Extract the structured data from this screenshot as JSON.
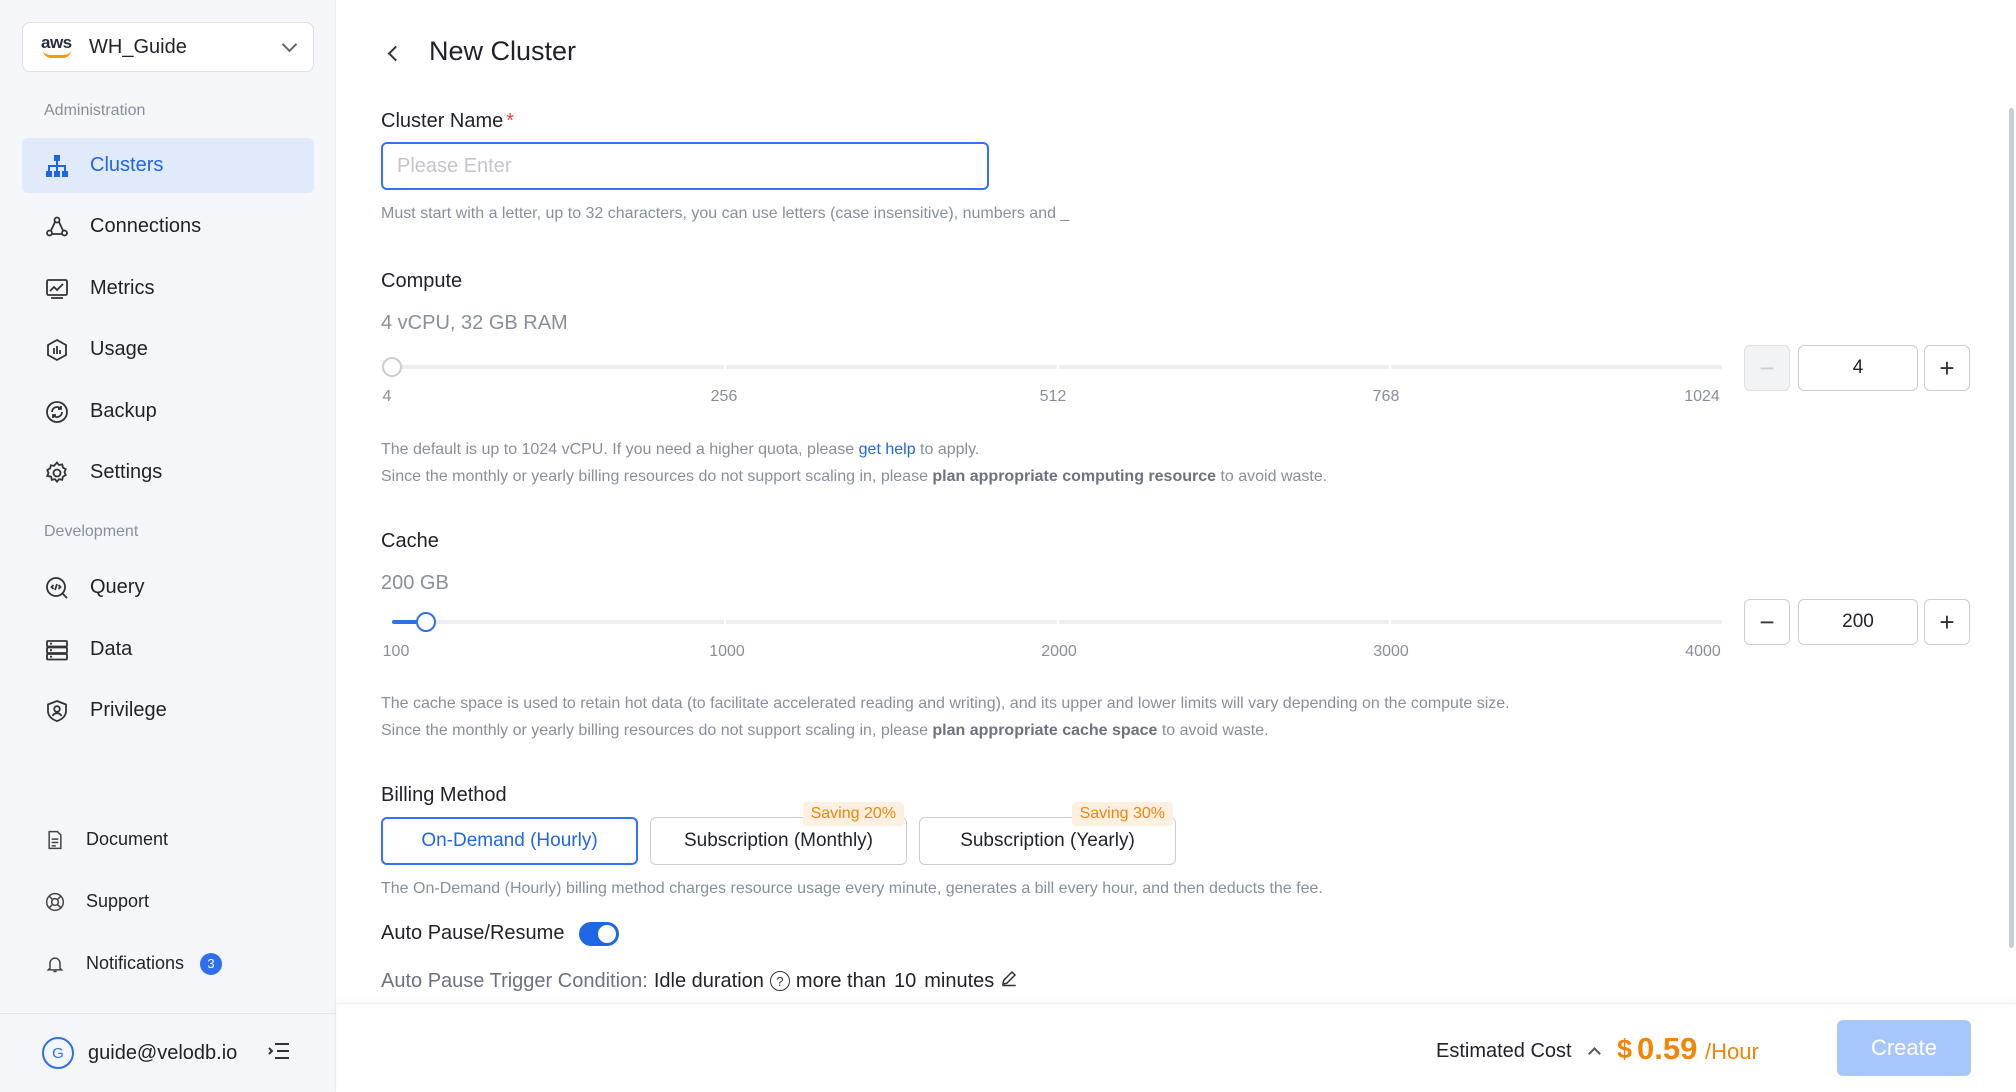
{
  "sidebar": {
    "workspace": {
      "cloud": "aws",
      "name": "WH_Guide"
    },
    "sections": {
      "administration": "Administration",
      "development": "Development"
    },
    "items": [
      {
        "label": "Clusters",
        "icon": "clusters-icon"
      },
      {
        "label": "Connections",
        "icon": "connections-icon"
      },
      {
        "label": "Metrics",
        "icon": "metrics-icon"
      },
      {
        "label": "Usage",
        "icon": "usage-icon"
      },
      {
        "label": "Backup",
        "icon": "backup-icon"
      },
      {
        "label": "Settings",
        "icon": "gear-icon"
      },
      {
        "label": "Query",
        "icon": "query-icon"
      },
      {
        "label": "Data",
        "icon": "data-icon"
      },
      {
        "label": "Privilege",
        "icon": "privilege-icon"
      }
    ],
    "bottom_items": [
      {
        "label": "Document",
        "icon": "document-icon"
      },
      {
        "label": "Support",
        "icon": "support-icon"
      },
      {
        "label": "Notifications",
        "icon": "bell-icon",
        "badge": "3"
      }
    ],
    "user": {
      "avatar": "G",
      "email": "guide@velodb.io"
    }
  },
  "page": {
    "title": "New Cluster",
    "cluster_name": {
      "label": "Cluster Name",
      "required_mark": "*",
      "placeholder": "Please Enter",
      "value": "",
      "hint": "Must start with a letter, up to 32 characters, you can use letters (case insensitive), numbers and _"
    },
    "compute": {
      "label": "Compute",
      "summary": "4 vCPU, 32 GB RAM",
      "ticks": [
        "4",
        "256",
        "512",
        "768",
        "1024"
      ],
      "min": 4,
      "max": 1024,
      "value": "4",
      "hint1_pre": "The default is up to 1024 vCPU. If you need a higher quota, please ",
      "hint1_link": "get help",
      "hint1_post": " to apply.",
      "hint2_pre": "Since the monthly or yearly billing resources do not support scaling in, please ",
      "hint2_bold": "plan appropriate computing resource",
      "hint2_post": " to avoid waste."
    },
    "cache": {
      "label": "Cache",
      "summary": "200 GB",
      "ticks": [
        "100",
        "1000",
        "2000",
        "3000",
        "4000"
      ],
      "min": 100,
      "max": 4000,
      "value": "200",
      "hint1": "The cache space is used to retain hot data (to facilitate accelerated reading and writing), and its upper and lower limits will vary depending on the compute size.",
      "hint2_pre": "Since the monthly or yearly billing resources do not support scaling in, please ",
      "hint2_bold": "plan appropriate cache space",
      "hint2_post": " to avoid waste."
    },
    "billing": {
      "label": "Billing Method",
      "options": [
        {
          "label": "On-Demand (Hourly)",
          "selected": true
        },
        {
          "label": "Subscription (Monthly)",
          "saving": "Saving 20%"
        },
        {
          "label": "Subscription (Yearly)",
          "saving": "Saving 30%"
        }
      ],
      "hint": "The On-Demand (Hourly) billing method charges resource usage every minute, generates a bill every hour, and then deducts the fee."
    },
    "auto_pause": {
      "label": "Auto Pause/Resume",
      "enabled": true,
      "trigger_label": "Auto Pause Trigger Condition:",
      "trigger_metric": "Idle duration",
      "trigger_more": "more than",
      "trigger_value": "10",
      "trigger_unit": "minutes"
    }
  },
  "footer": {
    "estimated_label": "Estimated Cost",
    "currency": "$",
    "price": "0.59",
    "unit": "/Hour",
    "create_label": "Create"
  },
  "colors": {
    "accent": "#1f66e5",
    "price": "#f0850a",
    "active_bg": "#e1eafb"
  }
}
